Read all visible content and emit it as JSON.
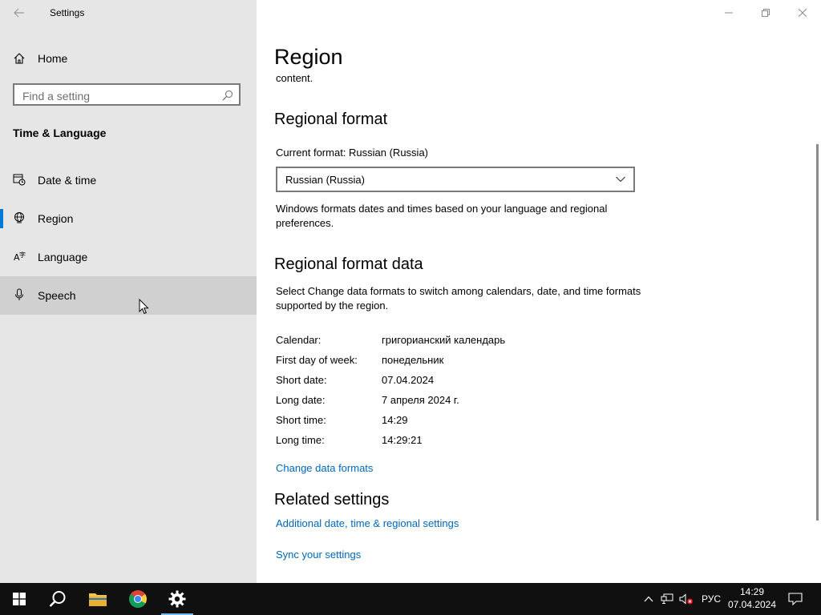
{
  "app": {
    "title": "Settings"
  },
  "sidebar": {
    "home_label": "Home",
    "search_placeholder": "Find a setting",
    "section_title": "Time & Language",
    "items": [
      {
        "label": "Date & time",
        "icon": "calendar-clock-icon"
      },
      {
        "label": "Region",
        "icon": "globe-region-icon",
        "selected": true
      },
      {
        "label": "Language",
        "icon": "language-icon"
      },
      {
        "label": "Speech",
        "icon": "microphone-icon"
      }
    ]
  },
  "page": {
    "title": "Region",
    "clipped_text": "content.",
    "regional_format": {
      "heading": "Regional format",
      "current_label": "Current format: Russian (Russia)",
      "dropdown_value": "Russian (Russia)",
      "description": "Windows formats dates and times based on your language and regional preferences."
    },
    "regional_format_data": {
      "heading": "Regional format data",
      "description": "Select Change data formats to switch among calendars, date, and time formats supported by the region.",
      "rows": [
        {
          "key": "Calendar:",
          "value": "григорианский календарь"
        },
        {
          "key": "First day of week:",
          "value": "понедельник"
        },
        {
          "key": "Short date:",
          "value": "07.04.2024"
        },
        {
          "key": "Long date:",
          "value": "7 апреля 2024 г."
        },
        {
          "key": "Short time:",
          "value": "14:29"
        },
        {
          "key": "Long time:",
          "value": "14:29:21"
        }
      ],
      "change_link": "Change data formats"
    },
    "related": {
      "heading": "Related settings",
      "links": [
        "Additional date, time & regional settings",
        "Sync your settings"
      ]
    }
  },
  "taskbar": {
    "language": "РУС",
    "time": "14:29",
    "date": "07.04.2024",
    "accent_color": "#0078d7"
  }
}
